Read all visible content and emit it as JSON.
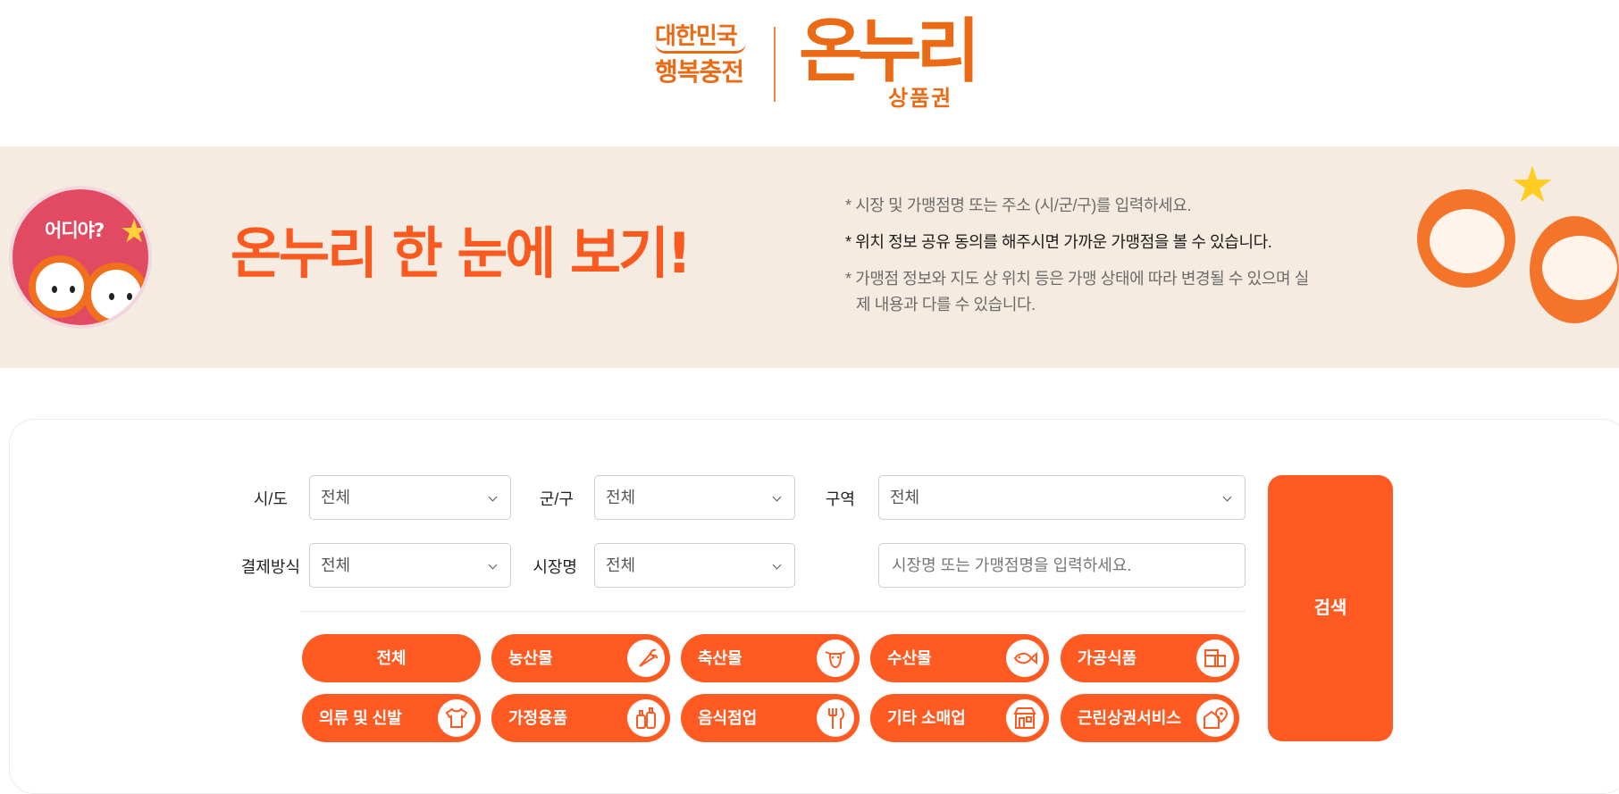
{
  "header": {
    "logo_left_line1": "대한민국",
    "logo_left_line2": "행복충전",
    "logo_right_main": "온누리",
    "logo_right_sub": "상품권"
  },
  "banner": {
    "badge_text": "어디야?",
    "title": "온누리 한 눈에 보기!",
    "notes": [
      "* 시장 및 가맹점명 또는 주소 (시/군/구)를 입력하세요.",
      "* 위치 정보 공유 동의를 해주시면 가까운 가맹점을 볼 수 있습니다.",
      "* 가맹점 정보와 지도 상 위치 등은 가맹 상태에 따라 변경될 수 있으며 실제 내용과 다를 수 있습니다."
    ]
  },
  "filters": {
    "sido_label": "시/도",
    "sido_value": "전체",
    "gungu_label": "군/구",
    "gungu_value": "전체",
    "area_label": "구역",
    "area_value": "전체",
    "payment_label": "결제방식",
    "payment_value": "전체",
    "market_label": "시장명",
    "market_value": "전체",
    "keyword_placeholder": "시장명 또는 가맹점명을 입력하세요."
  },
  "search_label": "검색",
  "categories": [
    {
      "label": "전체",
      "icon": null
    },
    {
      "label": "농산물",
      "icon": "vegetable-icon"
    },
    {
      "label": "축산물",
      "icon": "cow-icon"
    },
    {
      "label": "수산물",
      "icon": "fish-icon"
    },
    {
      "label": "가공식품",
      "icon": "processed-food-icon"
    },
    {
      "label": "의류 및 신발",
      "icon": "clothing-icon"
    },
    {
      "label": "가정용품",
      "icon": "household-icon"
    },
    {
      "label": "음식점업",
      "icon": "cutlery-icon"
    },
    {
      "label": "기타 소매업",
      "icon": "store-icon"
    },
    {
      "label": "근린상권서비스",
      "icon": "location-shop-icon"
    }
  ],
  "colors": {
    "accent": "#fe5a22",
    "brand": "#ea6a16",
    "banner_bg": "#f6ebe1"
  }
}
